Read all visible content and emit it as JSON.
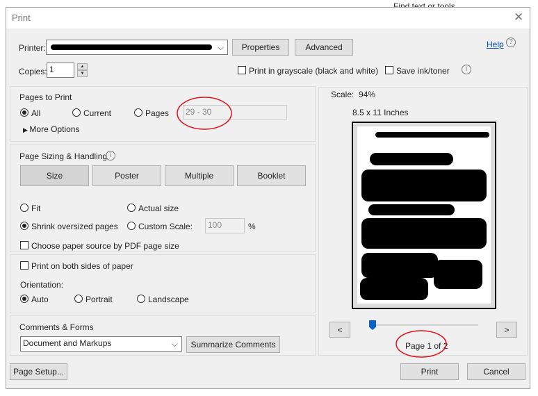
{
  "background": {
    "find_text": "Find text or tools"
  },
  "dialog": {
    "title": "Print",
    "printer_label": "Printer:",
    "properties": "Properties",
    "advanced": "Advanced",
    "help": "Help",
    "copies_label": "Copies:",
    "copies_value": "1",
    "grayscale": "Print in grayscale (black and white)",
    "save_ink": "Save ink/toner",
    "pages_to_print": {
      "title": "Pages to Print",
      "all": "All",
      "current": "Current",
      "pages": "Pages",
      "pages_value": "29 - 30",
      "more_options": "More Options"
    },
    "sizing": {
      "title": "Page Sizing & Handling",
      "tabs": [
        "Size",
        "Poster",
        "Multiple",
        "Booklet"
      ],
      "fit": "Fit",
      "actual": "Actual size",
      "shrink": "Shrink oversized pages",
      "custom": "Custom Scale:",
      "custom_value": "100",
      "percent": "%",
      "paper_source": "Choose paper source by PDF page size"
    },
    "both_sides": "Print on both sides of paper",
    "orientation": {
      "title": "Orientation:",
      "auto": "Auto",
      "portrait": "Portrait",
      "landscape": "Landscape"
    },
    "comments": {
      "title": "Comments & Forms",
      "select": "Document and Markups",
      "summarize": "Summarize Comments"
    },
    "preview": {
      "scale": "Scale:  94%",
      "paper": "8.5 x 11 Inches",
      "page_indicator": "Page 1 of 2",
      "prev": "<",
      "next": ">",
      "slider_fraction": 0
    },
    "page_setup": "Page Setup...",
    "print": "Print",
    "cancel": "Cancel"
  },
  "colors": {
    "annotation": "#e0101a",
    "accent": "#0a64c8",
    "link": "#0645ad"
  }
}
